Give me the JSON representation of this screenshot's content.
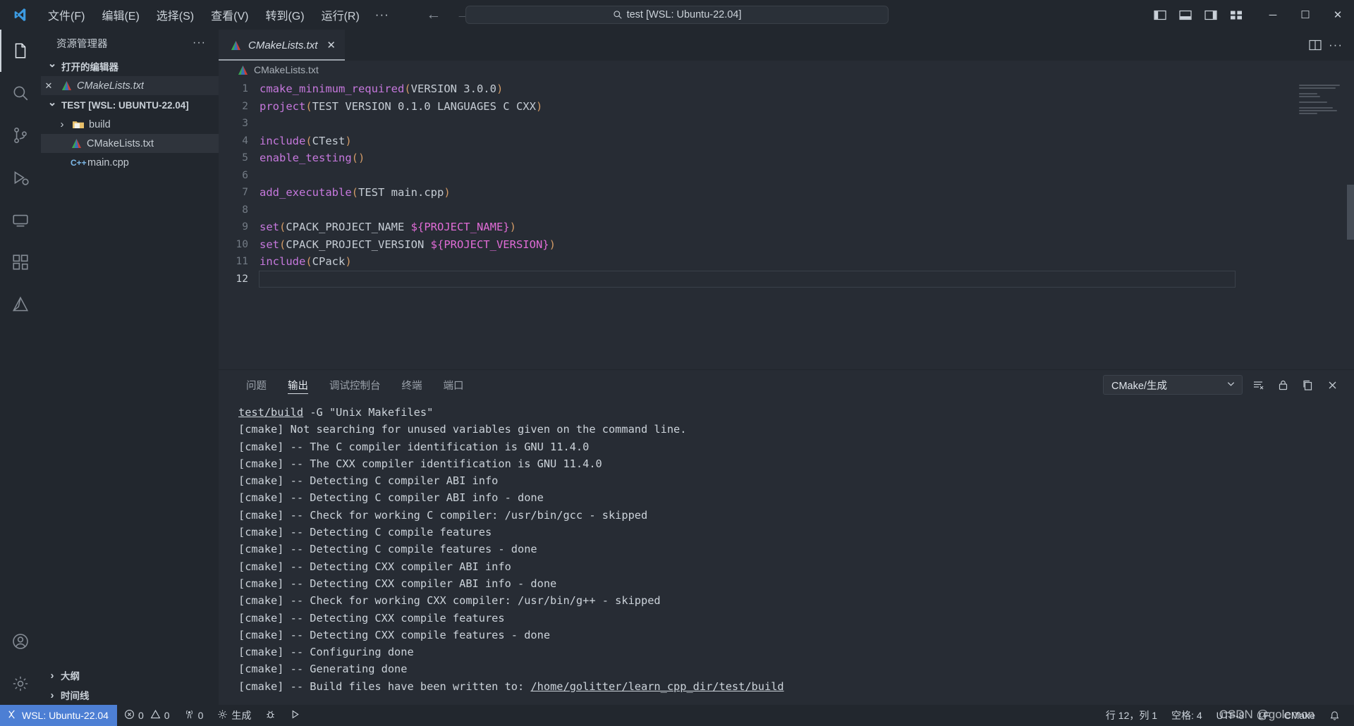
{
  "titlebar": {
    "logo_icon": "vscode-logo-icon",
    "menus": [
      "文件(F)",
      "编辑(E)",
      "选择(S)",
      "查看(V)",
      "转到(G)",
      "运行(R)"
    ],
    "more_label": "···",
    "back_icon": "arrow-left-icon",
    "forward_icon": "arrow-right-icon",
    "search": {
      "icon": "search-icon",
      "value": "test [WSL: Ubuntu-22.04]"
    },
    "layout_icons": [
      "toggle-primary-sidebar-icon",
      "toggle-panel-icon",
      "toggle-secondary-sidebar-icon",
      "customize-layout-icon"
    ],
    "window_buttons": {
      "minimize": "─",
      "maximize": "☐",
      "close": "✕"
    }
  },
  "activitybar": {
    "items": [
      {
        "name": "explorer",
        "icon": "files-icon",
        "active": true
      },
      {
        "name": "search",
        "icon": "search-icon",
        "active": false
      },
      {
        "name": "source-control",
        "icon": "source-control-icon",
        "active": false
      },
      {
        "name": "run-and-debug",
        "icon": "debug-icon",
        "active": false
      },
      {
        "name": "remote-explorer",
        "icon": "remote-explorer-icon",
        "active": false
      },
      {
        "name": "extensions",
        "icon": "extensions-icon",
        "active": false
      },
      {
        "name": "cmake",
        "icon": "cmake-icon",
        "active": false
      }
    ],
    "bottom": [
      {
        "name": "accounts",
        "icon": "account-icon"
      },
      {
        "name": "manage",
        "icon": "gear-icon"
      }
    ]
  },
  "sidebar": {
    "title": "资源管理器",
    "more_actions": "···",
    "open_editors": {
      "label": "打开的编辑器",
      "expanded": true,
      "items": [
        {
          "name": "CMakeLists.txt",
          "icon": "cmake-file-icon",
          "close": "✕",
          "italic": true
        }
      ]
    },
    "workspace": {
      "label": "TEST [WSL: UBUNTU-22.04]",
      "expanded": true,
      "items": [
        {
          "name": "build",
          "icon": "folder-icon",
          "type": "folder",
          "expanded": false,
          "selected": false
        },
        {
          "name": "CMakeLists.txt",
          "icon": "cmake-file-icon",
          "type": "file",
          "selected": true
        },
        {
          "name": "main.cpp",
          "icon": "cpp-file-icon",
          "type": "file",
          "selected": false
        }
      ]
    },
    "collapsed_sections": [
      {
        "label": "大纲"
      },
      {
        "label": "时间线"
      }
    ]
  },
  "editor": {
    "tab": {
      "label": "CMakeLists.txt",
      "icon": "cmake-file-icon",
      "close": "✕",
      "preview": true
    },
    "tab_actions": [
      "split-editor-icon",
      "more-actions-icon"
    ],
    "breadcrumb": {
      "icon": "cmake-file-icon",
      "label": "CMakeLists.txt"
    },
    "lines": [
      {
        "n": "1",
        "tokens": [
          {
            "t": "cmake_minimum_required",
            "c": "fn"
          },
          {
            "t": "(",
            "c": "paren"
          },
          {
            "t": "VERSION 3.0.0",
            "c": "arg"
          },
          {
            "t": ")",
            "c": "paren"
          }
        ]
      },
      {
        "n": "2",
        "tokens": [
          {
            "t": "project",
            "c": "fn"
          },
          {
            "t": "(",
            "c": "paren"
          },
          {
            "t": "TEST VERSION 0.1.0 LANGUAGES C CXX",
            "c": "arg"
          },
          {
            "t": ")",
            "c": "paren"
          }
        ]
      },
      {
        "n": "3",
        "tokens": []
      },
      {
        "n": "4",
        "tokens": [
          {
            "t": "include",
            "c": "fn"
          },
          {
            "t": "(",
            "c": "paren"
          },
          {
            "t": "CTest",
            "c": "arg"
          },
          {
            "t": ")",
            "c": "paren"
          }
        ]
      },
      {
        "n": "5",
        "tokens": [
          {
            "t": "enable_testing",
            "c": "fn"
          },
          {
            "t": "(",
            "c": "paren"
          },
          {
            "t": ")",
            "c": "paren"
          }
        ]
      },
      {
        "n": "6",
        "tokens": []
      },
      {
        "n": "7",
        "tokens": [
          {
            "t": "add_executable",
            "c": "fn"
          },
          {
            "t": "(",
            "c": "paren"
          },
          {
            "t": "TEST main.cpp",
            "c": "arg"
          },
          {
            "t": ")",
            "c": "paren"
          }
        ]
      },
      {
        "n": "8",
        "tokens": []
      },
      {
        "n": "9",
        "tokens": [
          {
            "t": "set",
            "c": "fn"
          },
          {
            "t": "(",
            "c": "paren"
          },
          {
            "t": "CPACK_PROJECT_NAME ",
            "c": "arg"
          },
          {
            "t": "${PROJECT_NAME}",
            "c": "var"
          },
          {
            "t": ")",
            "c": "paren"
          }
        ]
      },
      {
        "n": "10",
        "tokens": [
          {
            "t": "set",
            "c": "fn"
          },
          {
            "t": "(",
            "c": "paren"
          },
          {
            "t": "CPACK_PROJECT_VERSION ",
            "c": "arg"
          },
          {
            "t": "${PROJECT_VERSION}",
            "c": "var"
          },
          {
            "t": ")",
            "c": "paren"
          }
        ]
      },
      {
        "n": "11",
        "tokens": [
          {
            "t": "include",
            "c": "fn"
          },
          {
            "t": "(",
            "c": "paren"
          },
          {
            "t": "CPack",
            "c": "arg"
          },
          {
            "t": ")",
            "c": "paren"
          }
        ]
      },
      {
        "n": "12",
        "tokens": [],
        "current": true
      }
    ]
  },
  "panel": {
    "tabs": [
      {
        "label": "问题",
        "active": false
      },
      {
        "label": "输出",
        "active": true
      },
      {
        "label": "调试控制台",
        "active": false
      },
      {
        "label": "终端",
        "active": false
      },
      {
        "label": "端口",
        "active": false
      }
    ],
    "channel_select": {
      "value": "CMake/生成",
      "chevron": "⌄"
    },
    "actions": [
      "clear-output-icon",
      "lock-scroll-icon",
      "open-in-editor-icon",
      "close-panel-icon"
    ],
    "output_lines": [
      {
        "segments": [
          {
            "t": "test/build",
            "link": true
          },
          {
            "t": " -G \"Unix Makefiles\""
          }
        ]
      },
      {
        "segments": [
          {
            "t": "[cmake] Not searching for unused variables given on the command line."
          }
        ]
      },
      {
        "segments": [
          {
            "t": "[cmake] -- The C compiler identification is GNU 11.4.0"
          }
        ]
      },
      {
        "segments": [
          {
            "t": "[cmake] -- The CXX compiler identification is GNU 11.4.0"
          }
        ]
      },
      {
        "segments": [
          {
            "t": "[cmake] -- Detecting C compiler ABI info"
          }
        ]
      },
      {
        "segments": [
          {
            "t": "[cmake] -- Detecting C compiler ABI info - done"
          }
        ]
      },
      {
        "segments": [
          {
            "t": "[cmake] -- Check for working C compiler: /usr/bin/gcc - skipped"
          }
        ]
      },
      {
        "segments": [
          {
            "t": "[cmake] -- Detecting C compile features"
          }
        ]
      },
      {
        "segments": [
          {
            "t": "[cmake] -- Detecting C compile features - done"
          }
        ]
      },
      {
        "segments": [
          {
            "t": "[cmake] -- Detecting CXX compiler ABI info"
          }
        ]
      },
      {
        "segments": [
          {
            "t": "[cmake] -- Detecting CXX compiler ABI info - done"
          }
        ]
      },
      {
        "segments": [
          {
            "t": "[cmake] -- Check for working CXX compiler: /usr/bin/g++ - skipped"
          }
        ]
      },
      {
        "segments": [
          {
            "t": "[cmake] -- Detecting CXX compile features"
          }
        ]
      },
      {
        "segments": [
          {
            "t": "[cmake] -- Detecting CXX compile features - done"
          }
        ]
      },
      {
        "segments": [
          {
            "t": "[cmake] -- Configuring done"
          }
        ]
      },
      {
        "segments": [
          {
            "t": "[cmake] -- Generating done"
          }
        ]
      },
      {
        "segments": [
          {
            "t": "[cmake] -- Build files have been written to: "
          },
          {
            "t": "/home/golitter/learn_cpp_dir/test/build",
            "link": true
          }
        ]
      }
    ]
  },
  "statusbar": {
    "remote": {
      "icon": "remote-indicator-icon",
      "label": "WSL: Ubuntu-22.04"
    },
    "problems": {
      "errors_icon": "error-icon",
      "errors": "0",
      "warnings_icon": "warning-icon",
      "warnings": "0"
    },
    "ports": {
      "icon": "radio-tower-icon",
      "count": "0"
    },
    "cmake_build": {
      "icon": "gear-icon",
      "label": "生成"
    },
    "debug_icon": "bug-icon",
    "run_icon": "play-icon",
    "right": [
      {
        "name": "cursor-position",
        "label": "行 12，列 1"
      },
      {
        "name": "indentation",
        "label": "空格: 4"
      },
      {
        "name": "encoding",
        "label": "UTF-8"
      },
      {
        "name": "eol",
        "label": "LF"
      },
      {
        "name": "language-mode",
        "label": "CMake"
      },
      {
        "name": "notifications",
        "label": "ὑ4"
      }
    ]
  },
  "watermark": "CSDN @golemon"
}
